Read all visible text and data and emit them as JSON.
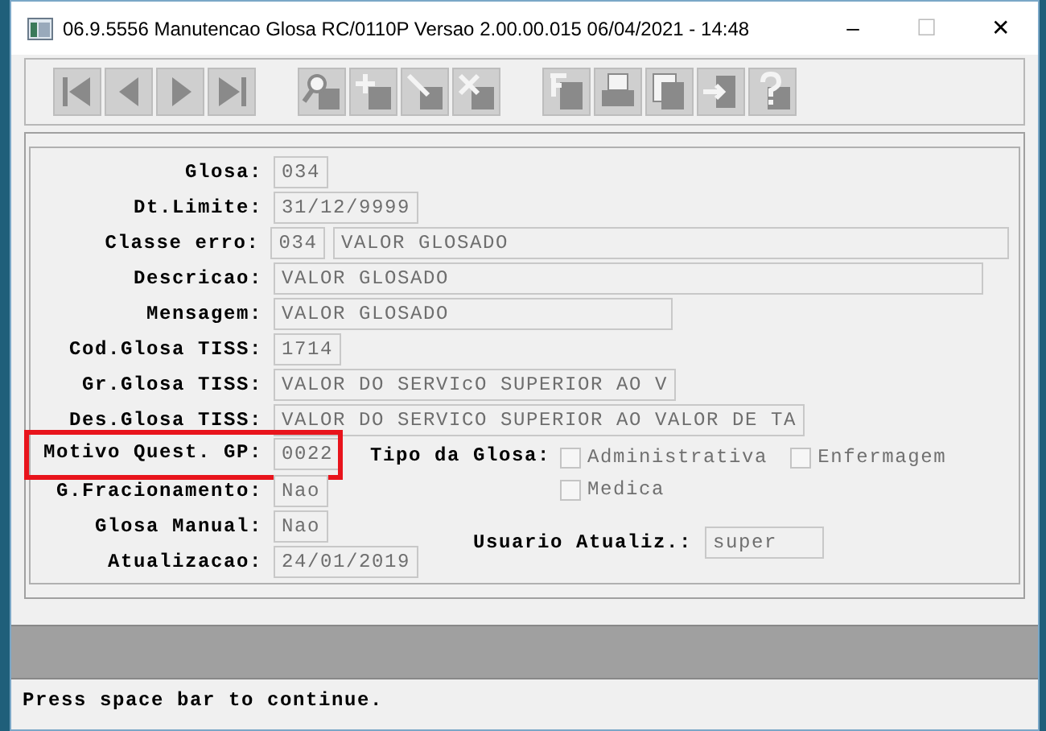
{
  "window": {
    "title": "06.9.5556 Manutencao  Glosa RC/0110P Versao 2.00.00.015 06/04/2021 - 14:48",
    "controls": [
      {
        "label": "–",
        "disabled": false
      },
      {
        "label": "☐",
        "disabled": true
      },
      {
        "label": "✕",
        "disabled": false
      }
    ]
  },
  "toolbar": [
    [
      {
        "kind": "first",
        "disabled": true
      },
      {
        "kind": "prev",
        "disabled": true
      },
      {
        "kind": "next",
        "disabled": true
      },
      {
        "kind": "last",
        "disabled": true
      }
    ],
    [
      {
        "kind": "search",
        "disabled": true
      },
      {
        "kind": "add",
        "disabled": true
      },
      {
        "kind": "edit",
        "disabled": true
      },
      {
        "kind": "delete",
        "disabled": true
      }
    ],
    [
      {
        "kind": "filter",
        "disabled": true
      },
      {
        "kind": "print",
        "disabled": true
      },
      {
        "kind": "copy",
        "disabled": true
      },
      {
        "kind": "exit",
        "disabled": true
      },
      {
        "kind": "help",
        "disabled": true
      }
    ]
  ],
  "form": {
    "fields": [
      {
        "label": "Glosa:",
        "values": [
          "034"
        ],
        "highlighted": false
      },
      {
        "label": "Dt.Limite:",
        "values": [
          "31/12/9999"
        ],
        "highlighted": false
      },
      {
        "label": "Classe erro:",
        "values": [
          "034",
          "VALOR GLOSADO"
        ],
        "highlighted": false
      },
      {
        "label": "Descricao:",
        "values": [
          "VALOR GLOSADO"
        ],
        "highlighted": false
      },
      {
        "label": "Mensagem:",
        "values": [
          "VALOR GLOSADO"
        ],
        "highlighted": false
      },
      {
        "label": "Cod.Glosa TISS:",
        "values": [
          "1714"
        ],
        "highlighted": false
      },
      {
        "label": "Gr.Glosa TISS:",
        "values": [
          "VALOR DO SERVIcO SUPERIOR AO V"
        ],
        "highlighted": false
      },
      {
        "label": "Des.Glosa TISS:",
        "values": [
          "VALOR DO SERVICO SUPERIOR AO VALOR DE TA"
        ],
        "highlighted": false
      },
      {
        "label": "Motivo Quest. GP:",
        "values": [
          "0022"
        ],
        "highlighted": true
      },
      {
        "label": "G.Fracionamento:",
        "values": [
          "Nao"
        ],
        "highlighted": false
      },
      {
        "label": "Glosa Manual:",
        "values": [
          "Nao"
        ],
        "highlighted": false
      },
      {
        "label": "Atualizacao:",
        "values": [
          "24/01/2019"
        ],
        "highlighted": false
      }
    ],
    "tipo_da_glosa": {
      "label": "Tipo da Glosa:",
      "options": [
        {
          "label": "Administrativa",
          "checked": false,
          "disabled": true
        },
        {
          "label": "Enfermagem",
          "checked": false,
          "disabled": true
        },
        {
          "label": "Medica",
          "checked": false,
          "disabled": true
        }
      ]
    },
    "usuario_atualiz": {
      "label": "Usuario Atualiz.:",
      "value": "super"
    }
  },
  "status_bar": "Press space bar to continue."
}
